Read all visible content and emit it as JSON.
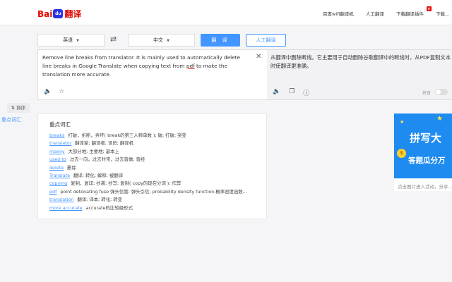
{
  "header": {
    "logo": {
      "bai": "Bai",
      "du": "du",
      "fanyi": "翻译"
    },
    "nav": [
      "百度wifi翻译机",
      "人工翻译",
      "下载翻译插件",
      "下载..."
    ]
  },
  "toolbar": {
    "source_lang": "英语",
    "target_lang": "中文",
    "translate_label": "翻 译",
    "human_label": "人工翻译"
  },
  "source": {
    "text_before": "Remove line breaks from translator. It is mainly used to automatically delete line breaks in Google Translate when copying text from ",
    "underlined": "pdf",
    "text_after": " to make the translation more accurate."
  },
  "target": {
    "text": "从翻译中删除断线。它主要用于自动删除谷歌翻译中的断线时，从PDF复制文本时使翻译更准确。",
    "pinyin_label": "拼音"
  },
  "side": {
    "sort_label": "⇅ 排序",
    "keyword_label": "重点词汇"
  },
  "vocab": {
    "title": "重点词汇",
    "items": [
      {
        "word": "breaks",
        "def": "打破，折断，弄坏( break的第三人称单数 ); 破; 打破; 突变"
      },
      {
        "word": "translator",
        "def": "翻译家; 翻译者; 译员; 翻译机"
      },
      {
        "word": "mainly",
        "def": "大部分地; 主要地; 基本上"
      },
      {
        "word": "used to",
        "def": "过去一向，过去时常，过去曾做; 曾经"
      },
      {
        "word": "delete",
        "def": "删除"
      },
      {
        "word": "Translate",
        "def": "翻译; 转化; 解释; 被翻译"
      },
      {
        "word": "copying",
        "def": "复制，复印; 抄袭; 抄写; 复制( copy的现在分词 ); 作弊"
      },
      {
        "word": "pdf",
        "def": "point detonating fuse 弹头信管; 弹头引信; probability density function 概率密度函数..."
      },
      {
        "word": "translation",
        "def": "翻译; 译本; 转化; 转变"
      },
      {
        "word": "more accurate",
        "def": "accurate的比较级形式"
      }
    ]
  },
  "ad": {
    "line1": "拼写大",
    "line2": "答题瓜分万",
    "caption": "点击图片进入活动，分享..."
  }
}
